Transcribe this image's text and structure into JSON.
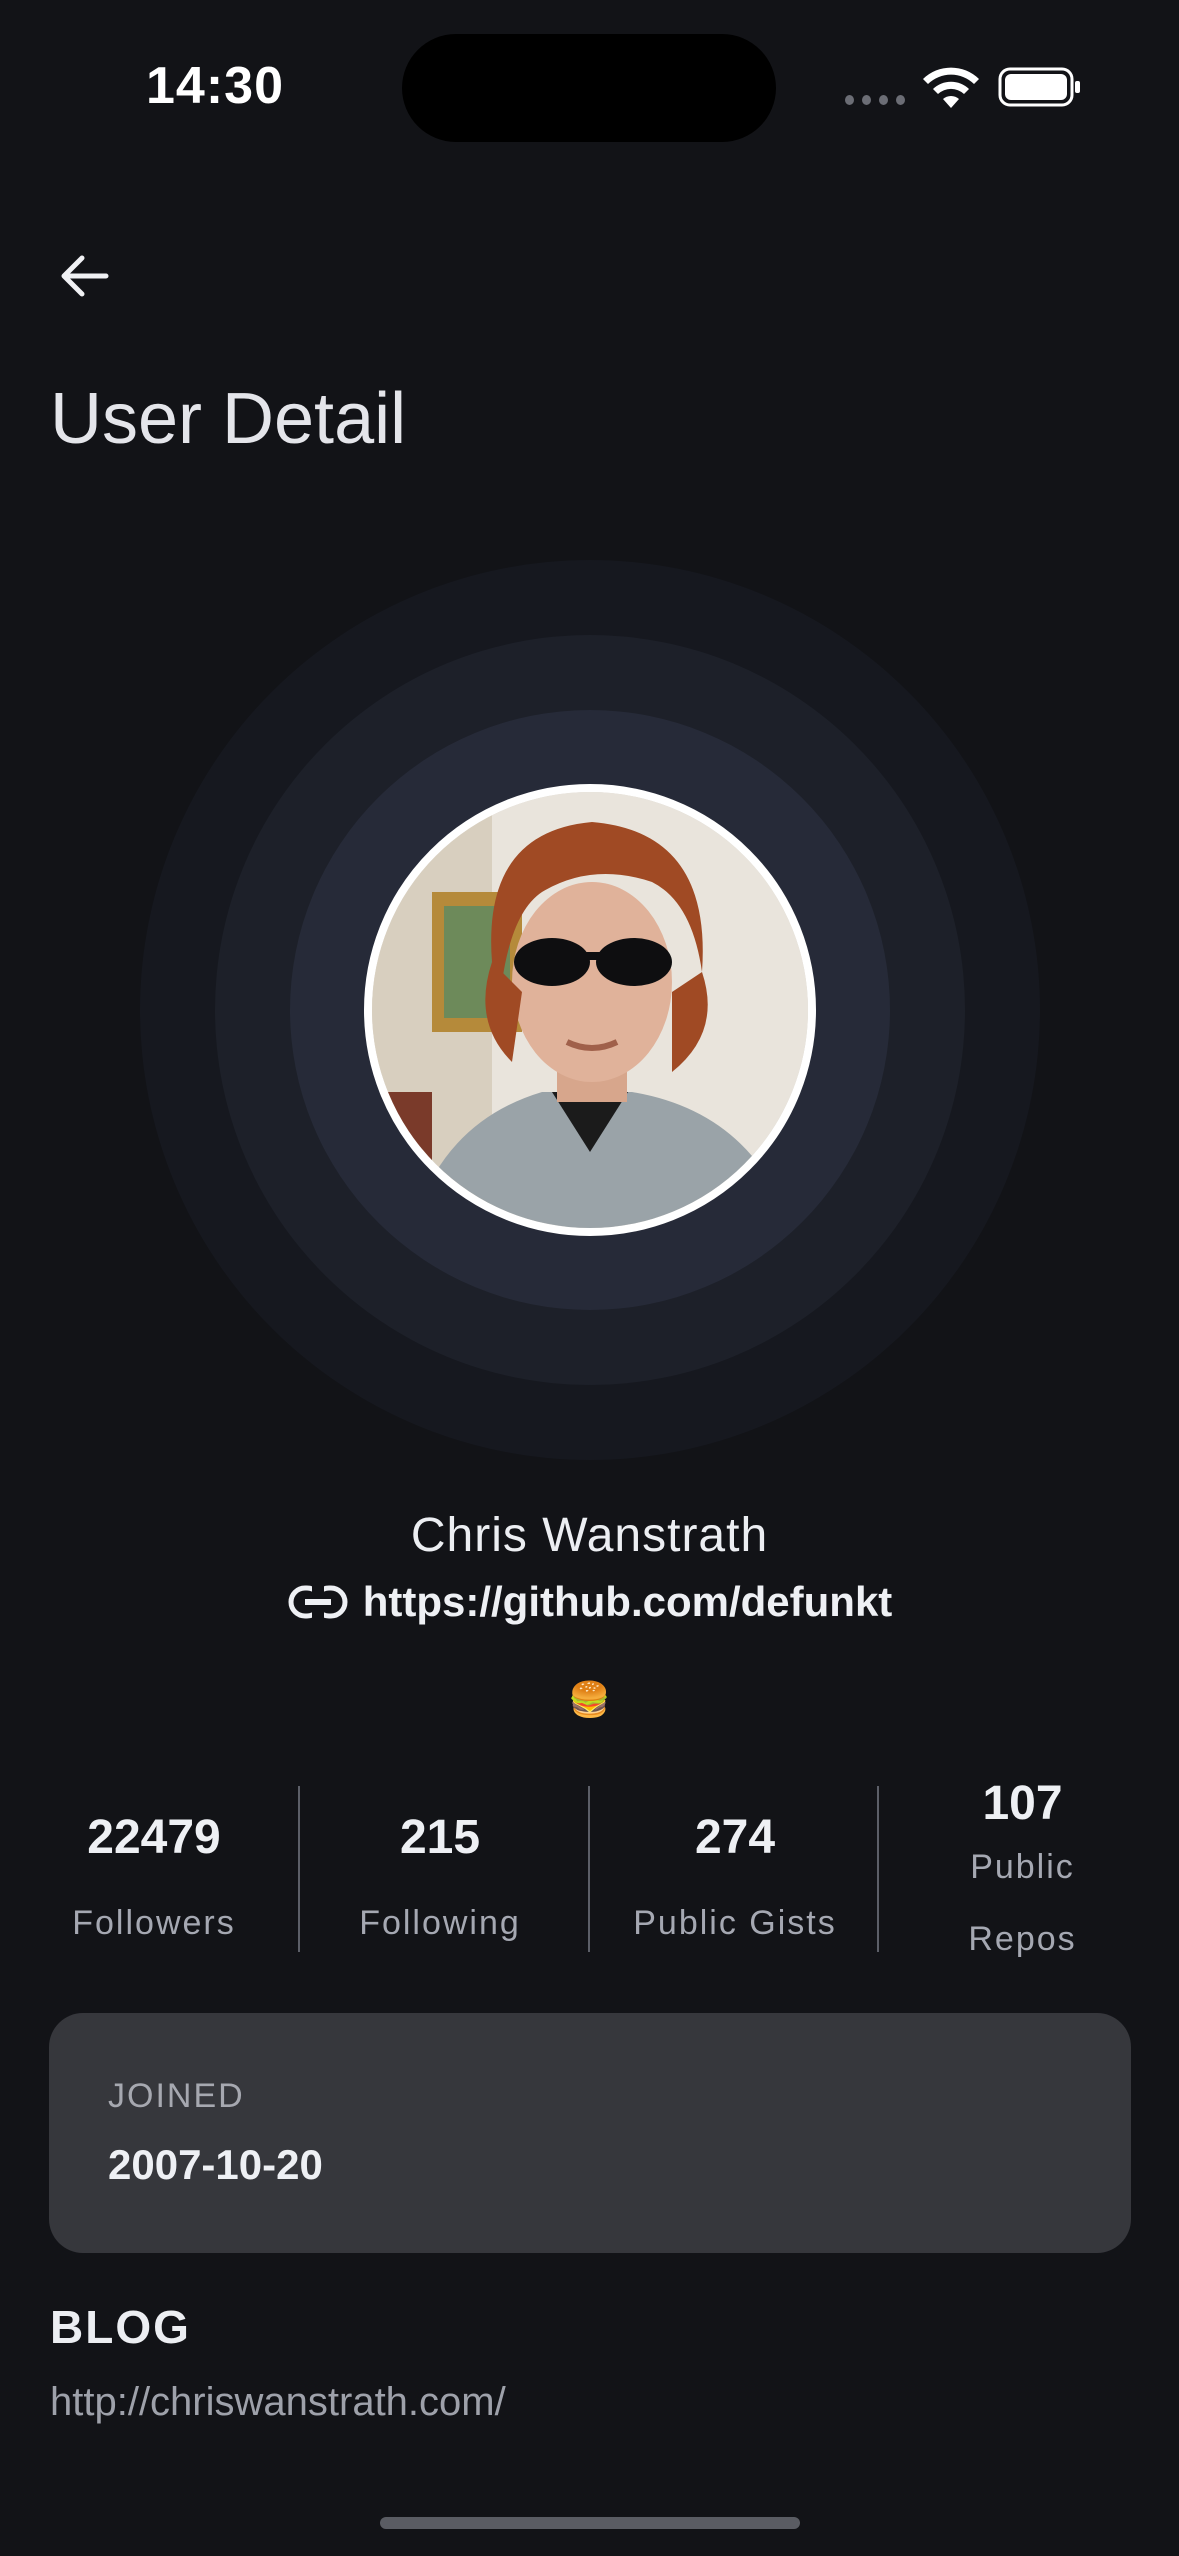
{
  "status_bar": {
    "time": "14:30"
  },
  "header": {
    "back_icon": "arrow-left-icon",
    "title": "User Detail"
  },
  "profile": {
    "avatar_description": "avatar-image",
    "name": "Chris Wanstrath",
    "link_icon": "link-icon",
    "url": "https://github.com/defunkt",
    "bio": "🍔"
  },
  "stats": [
    {
      "value": "22479",
      "label": "Followers"
    },
    {
      "value": "215",
      "label": "Following"
    },
    {
      "value": "274",
      "label": "Public Gists"
    },
    {
      "value": "107",
      "label_line1": "Public",
      "label_line2": "Repos"
    }
  ],
  "joined": {
    "label": "JOINED",
    "date": "2007-10-20"
  },
  "blog": {
    "heading": "BLOG",
    "url": "http://chriswanstrath.com/"
  },
  "colors": {
    "background": "#121317",
    "card": "#36373c",
    "ring_outer": "#16181f",
    "ring_mid": "#1d2029",
    "ring_inner": "#262a38"
  }
}
